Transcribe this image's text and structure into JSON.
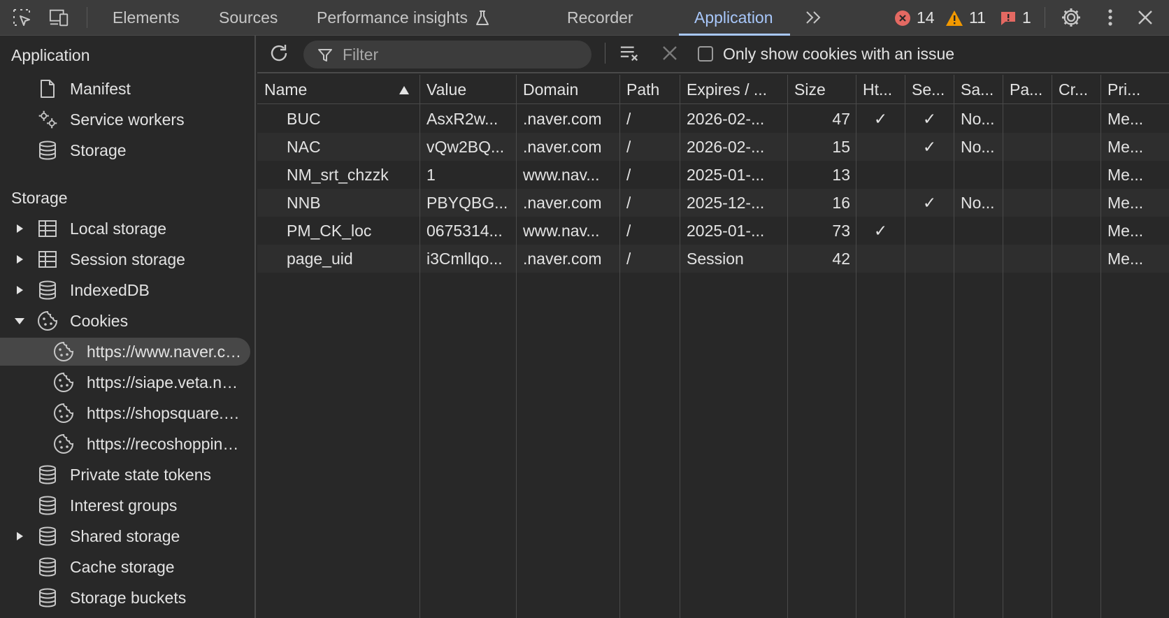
{
  "toolbar": {
    "tabs": [
      {
        "label": "Elements"
      },
      {
        "label": "Sources"
      },
      {
        "label": "Performance insights"
      },
      {
        "label": "Recorder"
      },
      {
        "label": "Application"
      }
    ],
    "errors": "14",
    "warnings": "11",
    "issues": "1"
  },
  "sidebar": {
    "application_heading": "Application",
    "app_items": [
      "Manifest",
      "Service workers",
      "Storage"
    ],
    "storage_heading": "Storage",
    "storage_items": [
      "Local storage",
      "Session storage",
      "IndexedDB",
      "Cookies"
    ],
    "cookie_items": [
      "https://www.naver.com",
      "https://siape.veta.naver.com",
      "https://shopsquare.naver.com",
      "https://recoshopping.naver.com"
    ],
    "other_items": [
      "Private state tokens",
      "Interest groups",
      "Shared storage",
      "Cache storage",
      "Storage buckets"
    ]
  },
  "cookies_toolbar": {
    "filter_placeholder": "Filter",
    "only_issue_label": "Only show cookies with an issue"
  },
  "table": {
    "columns": [
      "Name",
      "Value",
      "Domain",
      "Path",
      "Expires / ...",
      "Size",
      "Ht...",
      "Se...",
      "Sa...",
      "Pa...",
      "Cr...",
      "Pri..."
    ],
    "rows": [
      {
        "name": "BUC",
        "value": "AsxR2w...",
        "domain": ".naver.com",
        "path": "/",
        "expires": "2026-02-...",
        "size": "47",
        "http": "✓",
        "secure": "✓",
        "same": "No...",
        "pa": "",
        "cr": "",
        "pri": "Me..."
      },
      {
        "name": "NAC",
        "value": "vQw2BQ...",
        "domain": ".naver.com",
        "path": "/",
        "expires": "2026-02-...",
        "size": "15",
        "http": "",
        "secure": "✓",
        "same": "No...",
        "pa": "",
        "cr": "",
        "pri": "Me..."
      },
      {
        "name": "NM_srt_chzzk",
        "value": "1",
        "domain": "www.nav...",
        "path": "/",
        "expires": "2025-01-...",
        "size": "13",
        "http": "",
        "secure": "",
        "same": "",
        "pa": "",
        "cr": "",
        "pri": "Me..."
      },
      {
        "name": "NNB",
        "value": "PBYQBG...",
        "domain": ".naver.com",
        "path": "/",
        "expires": "2025-12-...",
        "size": "16",
        "http": "",
        "secure": "✓",
        "same": "No...",
        "pa": "",
        "cr": "",
        "pri": "Me..."
      },
      {
        "name": "PM_CK_loc",
        "value": "0675314...",
        "domain": "www.nav...",
        "path": "/",
        "expires": "2025-01-...",
        "size": "73",
        "http": "✓",
        "secure": "",
        "same": "",
        "pa": "",
        "cr": "",
        "pri": "Me..."
      },
      {
        "name": "page_uid",
        "value": "i3Cmllqo...",
        "domain": ".naver.com",
        "path": "/",
        "expires": "Session",
        "size": "42",
        "http": "",
        "secure": "",
        "same": "",
        "pa": "",
        "cr": "",
        "pri": "Me..."
      }
    ]
  },
  "colors": {
    "accent": "#a8c7fa",
    "error": "#e46962",
    "warning": "#f29900"
  }
}
